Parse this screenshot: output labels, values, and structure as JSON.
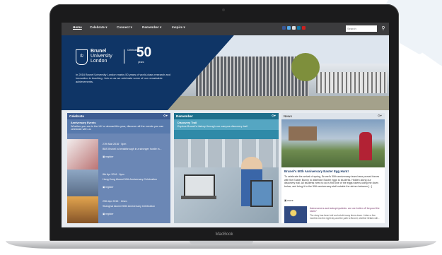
{
  "nav": {
    "items": [
      "Home",
      "Celebrate ▾",
      "Connect ▾",
      "Remember ▾",
      "Inspire ▾"
    ],
    "search_placeholder": "Search"
  },
  "hero": {
    "logo_line1": "Brunel",
    "logo_line2": "University",
    "logo_line3": "London",
    "celebrating": "Celebrating",
    "fifty": "50",
    "years": "years",
    "text": "In 2016 Brunel University London marks 50 years of world-class research and innovation in teaching. Join us as we celebrate some of our remarkable achievements."
  },
  "celebrate": {
    "header": "Celebrate",
    "sub_title": "Anniversary Events",
    "sub_text": "Whether you are in the UK or abroad this year, discover all the events you can celebrate with us",
    "events": [
      {
        "date": "27th Mar 2016 · 5pm",
        "title": "BBS Brunel: a breakthrough in a stronger hurdle in...",
        "register": "register"
      },
      {
        "date": "8th Apr 2016 · 6pm",
        "title": "Hong Kong Alumni 50th Anniversary Celebration",
        "register": "register"
      },
      {
        "date": "29th Apr 2016 · 12am",
        "title": "Shanghai Alumni 50th Anniversary Celebration",
        "register": "register"
      }
    ]
  },
  "remember": {
    "header": "Remember",
    "sub_title": "Discovery Trail",
    "sub_text": "Explore Brunel's history through our campus discovery trail"
  },
  "news": {
    "header": "News",
    "title": "Brunel's 50th Anniversary Easter Egg Hunt!",
    "body": "To celebrate the arrival of spring, Brunel's 50th anniversary team have proved forces with the Easter Bunny to distribute Easter eggs to students. Hidden along our discovery trail. All students need to do is find one of the eggs tokens using the clues below, and bring it to the 50th anniversary stall outside the atrium between [...]",
    "more": "more",
    "item2_title": "Astronomers and astrophysicists: are we better off beyond the stars?",
    "item2_body": "The story has been told and retold many times down. Listen a few months into the night sky and the path to Brunel, whether Britain will..."
  },
  "footer": {
    "brand": "MacBook"
  }
}
